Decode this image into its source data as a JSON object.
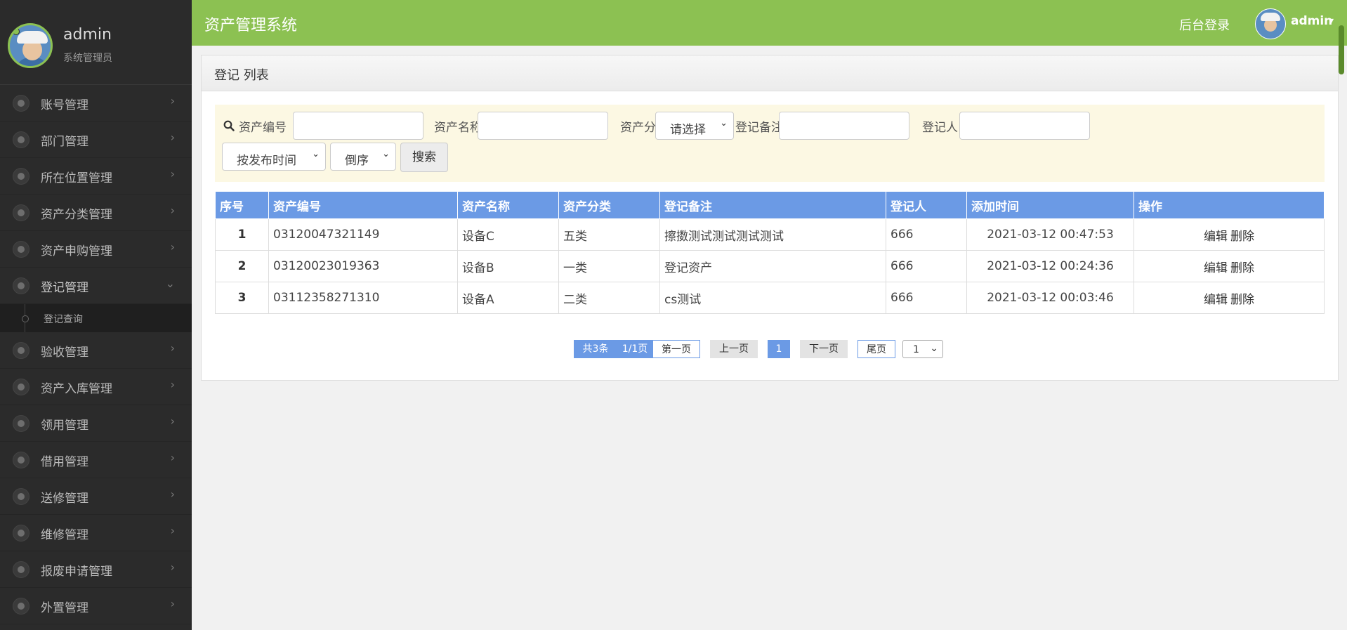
{
  "sidebar": {
    "user_name": "admin",
    "user_role": "系统管理员",
    "items": [
      {
        "label": "账号管理"
      },
      {
        "label": "部门管理"
      },
      {
        "label": "所在位置管理"
      },
      {
        "label": "资产分类管理"
      },
      {
        "label": "资产申购管理"
      },
      {
        "label": "登记管理"
      },
      {
        "label": "验收管理"
      },
      {
        "label": "资产入库管理"
      },
      {
        "label": "领用管理"
      },
      {
        "label": "借用管理"
      },
      {
        "label": "送修管理"
      },
      {
        "label": "维修管理"
      },
      {
        "label": "报废申请管理"
      },
      {
        "label": "外置管理"
      }
    ],
    "submenu_label": "登记查询"
  },
  "header": {
    "title": "资产管理系统",
    "backend_login": "后台登录",
    "user": "admin"
  },
  "panel": {
    "title": "登记 列表"
  },
  "search": {
    "asset_no_label": "资产编号",
    "asset_name_label": "资产名称",
    "category_label": "资产分类",
    "category_value": "请选择",
    "remark_label": "登记备注",
    "registrant_label": "登记人",
    "sort_field": "按发布时间",
    "sort_order": "倒序",
    "search_button": "搜索"
  },
  "table": {
    "headers": [
      "序号",
      "资产编号",
      "资产名称",
      "资产分类",
      "登记备注",
      "登记人",
      "添加时间",
      "操作"
    ],
    "rows": [
      {
        "no": "1",
        "asset_no": "03120047321149",
        "name": "设备C",
        "category": "五类",
        "remark": "擦擞测试测试测试测试",
        "registrant": "666",
        "time": "2021-03-12 00:47:53"
      },
      {
        "no": "2",
        "asset_no": "03120023019363",
        "name": "设备B",
        "category": "一类",
        "remark": "登记资产",
        "registrant": "666",
        "time": "2021-03-12 00:24:36"
      },
      {
        "no": "3",
        "asset_no": "03112358271310",
        "name": "设备A",
        "category": "二类",
        "remark": "cs测试",
        "registrant": "666",
        "time": "2021-03-12 00:03:46"
      }
    ],
    "edit_label": "编辑",
    "delete_label": "删除"
  },
  "pagination": {
    "total": "共3条",
    "pages": "1/1页",
    "first": "第一页",
    "prev": "上一页",
    "current": "1",
    "next": "下一页",
    "last": "尾页",
    "jump_value": "1"
  },
  "colors": {
    "accent": "#8cc152",
    "sidebar_bg": "#2b2b2b",
    "table_header": "#6b9ae5",
    "search_bg": "#fcf8e3"
  }
}
